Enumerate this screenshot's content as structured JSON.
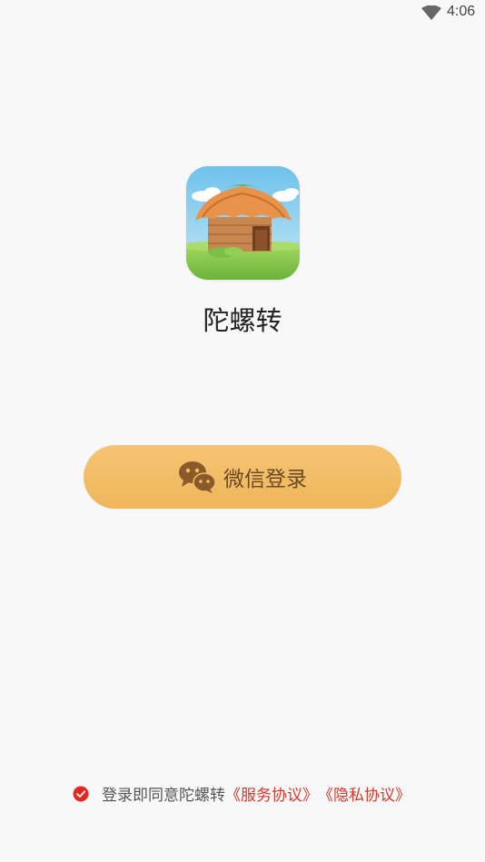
{
  "status_bar": {
    "time": "4:06",
    "wifi_icon": "wifi-icon"
  },
  "app": {
    "icon": "hut-app-icon",
    "name": "陀螺转"
  },
  "login": {
    "button_label": "微信登录",
    "button_icon": "wechat-icon"
  },
  "agreement": {
    "check_icon": "checked-circle-icon",
    "prefix": "登录即同意陀螺转",
    "service_link": "《服务协议》",
    "privacy_link": "《隐私协议》"
  },
  "colors": {
    "background": "#f8f8f8",
    "button": "#f2bd66",
    "button_text": "#6a4a22",
    "link": "#d9352b",
    "check": "#e32822"
  }
}
